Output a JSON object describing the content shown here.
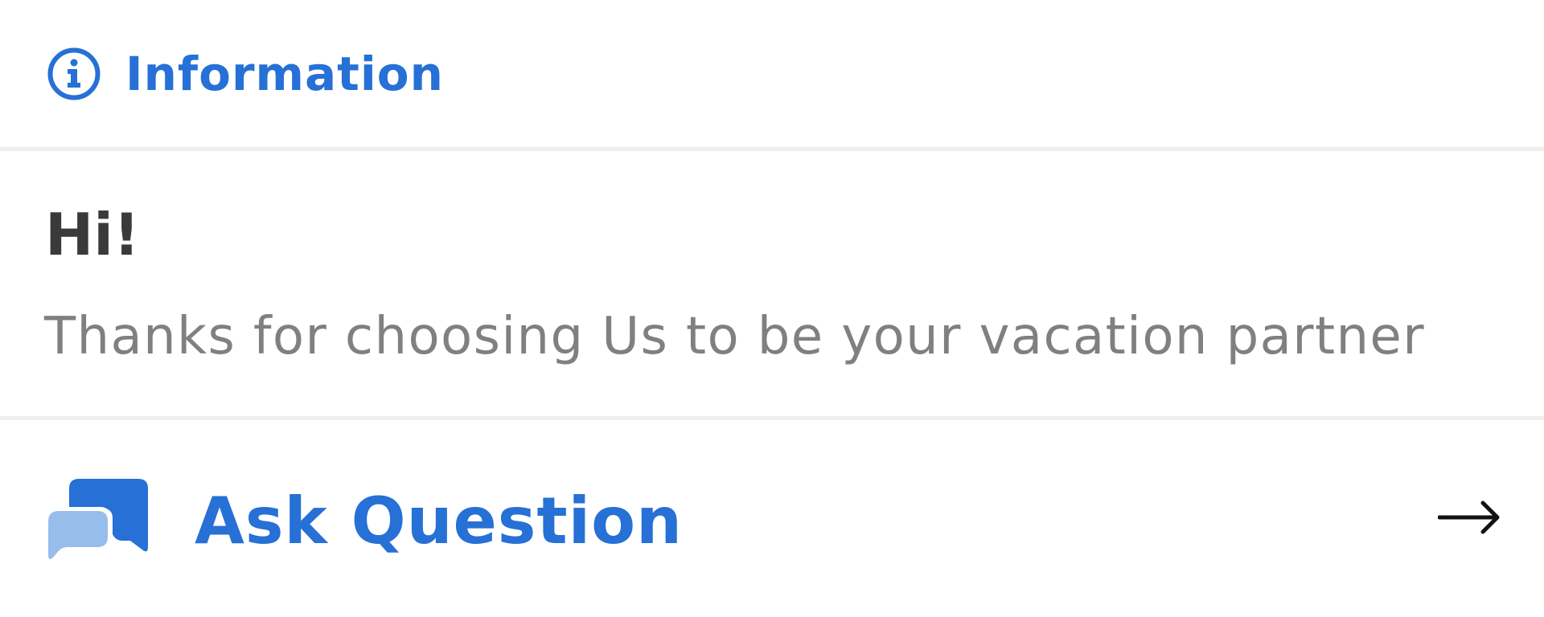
{
  "header": {
    "title": "Information",
    "icon": "info-icon",
    "accent_color": "#2670d6"
  },
  "content": {
    "greeting": "Hi!",
    "message": "Thanks for choosing Us to be your vacation partner"
  },
  "action": {
    "label": "Ask Question",
    "icon": "chat-bubbles-icon",
    "trailing_icon": "arrow-right-icon"
  },
  "colors": {
    "accent": "#2670d6",
    "accent_light": "#97bdec",
    "greeting_text": "#3a3a3a",
    "body_text": "#808080",
    "divider": "#efefef"
  }
}
